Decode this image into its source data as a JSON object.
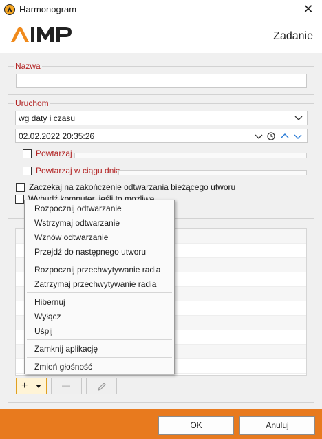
{
  "window": {
    "title": "Harmonogram",
    "close_symbol": "✕"
  },
  "header": {
    "title": "Zadanie",
    "logo_text": "AIMP"
  },
  "name_group": {
    "legend": "Nazwa",
    "value": ""
  },
  "run_group": {
    "legend": "Uruchom",
    "mode_value": "wg daty i czasu",
    "datetime_value": "02.02.2022 20:35:26",
    "repeat_label": "Powtarzaj",
    "repeat_daily_label": "Powtarzaj w ciągu dnia",
    "wait_label": "Zaczekaj na zakończenie odtwarzania bieżącego utworu",
    "wake_label": "Wybudź komputer, jeśli to możliwe"
  },
  "toolbar": {
    "add_symbol": "+",
    "remove_symbol": "—"
  },
  "menu": {
    "items": [
      "Rozpocznij odtwarzanie",
      "Wstrzymaj odtwarzanie",
      "Wznów odtwarzanie",
      "Przejdź do następnego utworu",
      "Rozpocznij przechwytywanie radia",
      "Zatrzymaj przechwytywanie radia",
      "Hibernuj",
      "Wyłącz",
      "Uśpij",
      "Zamknij aplikację",
      "Zmień głośność"
    ]
  },
  "footer": {
    "ok_label": "OK",
    "cancel_label": "Anuluj"
  },
  "colors": {
    "accent": "#e87a1e",
    "legend": "#b22222"
  }
}
